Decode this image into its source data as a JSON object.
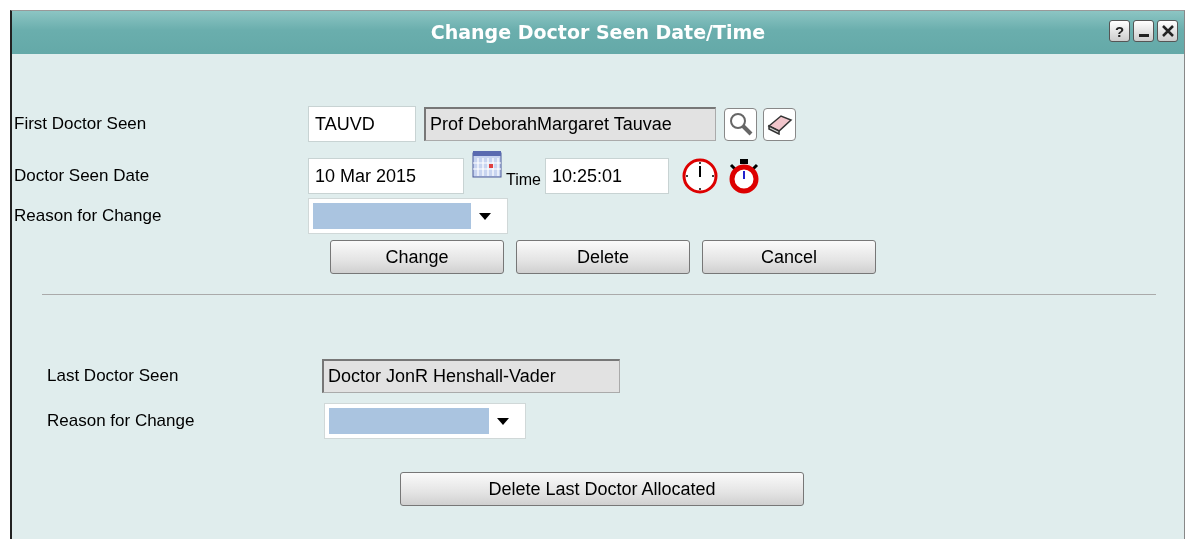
{
  "window": {
    "title": "Change Doctor Seen Date/Time",
    "help_button": "?"
  },
  "first_section": {
    "first_doctor": {
      "label": "First Doctor Seen",
      "code": "TAUVD",
      "name": "Prof DeborahMargaret Tauvae"
    },
    "date": {
      "label": "Doctor Seen Date",
      "value": "10 Mar 2015",
      "time_label": "Time",
      "time_value": "10:25:01"
    },
    "reason": {
      "label": "Reason for Change"
    },
    "buttons": [
      "Change",
      "Delete",
      "Cancel"
    ]
  },
  "last_section": {
    "last_doctor": {
      "label": "Last Doctor Seen",
      "name": "Doctor JonR Henshall-Vader"
    },
    "reason": {
      "label": "Reason for Change"
    },
    "button": "Delete Last Doctor Allocated"
  }
}
